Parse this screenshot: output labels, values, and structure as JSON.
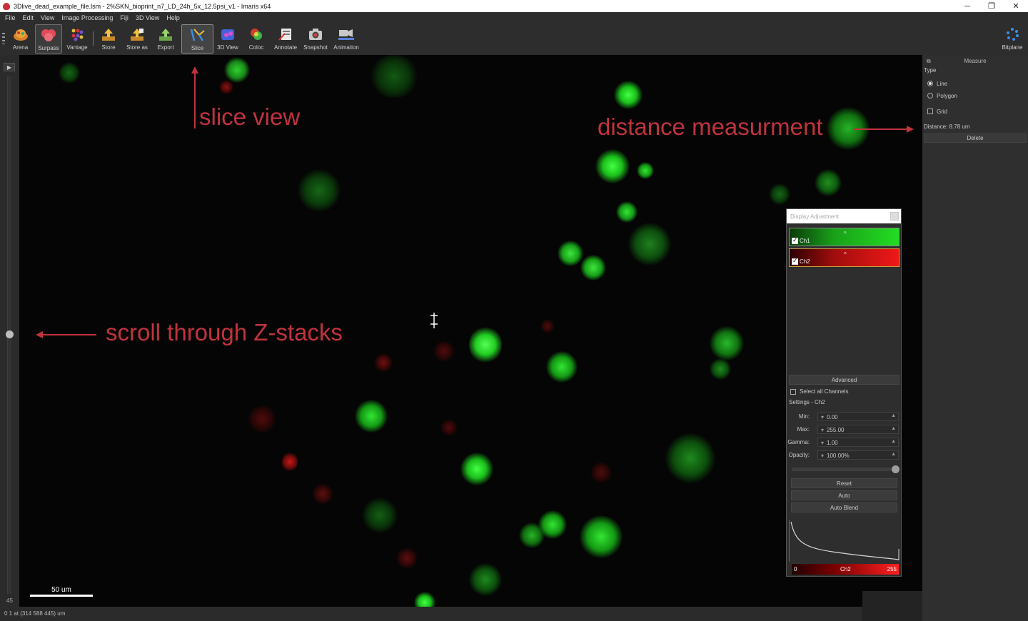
{
  "window": {
    "title": "3Dlive_dead_example_file.lsm - 2%SKN_bioprint_n7_LD_24h_5x_12.5psi_v1 - Imaris x64",
    "controls": [
      "─",
      "❐",
      "✕"
    ]
  },
  "menu": [
    "File",
    "Edit",
    "View",
    "Image Processing",
    "Fiji",
    "3D View",
    "Help"
  ],
  "toolbar": {
    "buttons": [
      {
        "label": "Arena",
        "icon": "arena-icon"
      },
      {
        "label": "Surpass",
        "icon": "surpass-icon",
        "state": "pressed"
      },
      {
        "label": "Vantage",
        "icon": "vantage-icon"
      },
      {
        "label": "Store",
        "icon": "store-icon"
      },
      {
        "label": "Store as",
        "icon": "store-as-icon"
      },
      {
        "label": "Export",
        "icon": "export-icon"
      },
      {
        "label": "Slice",
        "icon": "slice-icon",
        "state": "active"
      },
      {
        "label": "3D View",
        "icon": "3d-view-icon"
      },
      {
        "label": "Coloc",
        "icon": "coloc-icon"
      },
      {
        "label": "Annotate",
        "icon": "annotate-icon"
      },
      {
        "label": "Snapshot",
        "icon": "snapshot-icon"
      },
      {
        "label": "Animation",
        "icon": "animation-icon"
      }
    ],
    "right_button": {
      "label": "Bitplane",
      "icon": "bitplane-icon"
    }
  },
  "zstack": {
    "play": "▶",
    "value": "45"
  },
  "viewport": {
    "scalebar": "50 um",
    "annotations": {
      "slice_view": "slice view",
      "distance": "distance measurment",
      "zscroll": "scroll through Z-stacks"
    },
    "accent_color": "#c0333d"
  },
  "measure_panel": {
    "title": "Measure",
    "type_label": "Type",
    "options": [
      {
        "label": "Line",
        "selected": true
      },
      {
        "label": "Polygon",
        "selected": false
      }
    ],
    "grid": {
      "label": "Grid",
      "checked": false
    },
    "distance": "Distance: 8.78 um",
    "delete": "Delete"
  },
  "display_adjustment": {
    "title": "Display Adjustment",
    "channels": [
      {
        "name": "Ch1",
        "color": "#1fd41f",
        "checked": true
      },
      {
        "name": "Ch2",
        "color": "#e81515",
        "checked": true
      }
    ],
    "advanced": "Advanced",
    "select_all": "Select all Channels",
    "settings_label": "Settings - Ch2",
    "fields": [
      {
        "label": "Min:",
        "value": "0.00"
      },
      {
        "label": "Max:",
        "value": "255.00"
      },
      {
        "label": "Gamma:",
        "value": "1.00"
      },
      {
        "label": "Opacity:",
        "value": "100.00%"
      }
    ],
    "opacity_level": 1.0,
    "buttons": [
      "Reset",
      "Auto",
      "Auto Blend"
    ],
    "colorbar": {
      "min": "0",
      "channel": "Ch2",
      "max": "255"
    }
  },
  "status": "0 1 at (314 588 445) um"
}
